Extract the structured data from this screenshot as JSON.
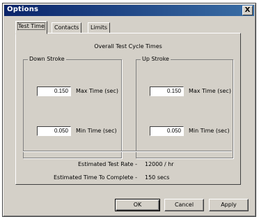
{
  "window": {
    "title": "Options",
    "close_glyph": "X"
  },
  "tabs": [
    {
      "label": "Test Time",
      "active": true
    },
    {
      "label": "Contacts",
      "active": false
    },
    {
      "label": "Limits",
      "active": false
    }
  ],
  "panel": {
    "heading": "Overall Test Cycle Times",
    "down_stroke": {
      "label": "Down Stroke",
      "max_value": "0.150",
      "max_label": "Max Time (sec)",
      "min_value": "0.050",
      "min_label": "Min Time (sec)"
    },
    "up_stroke": {
      "label": "Up Stroke",
      "max_value": "0.150",
      "max_label": "Max Time (sec)",
      "min_value": "0.050",
      "min_label": "Min Time (sec)"
    },
    "estimated_rate_label": "Estimated Test Rate -",
    "estimated_rate_value": "12000 / hr",
    "estimated_time_label": "Estimated Time To Complete -",
    "estimated_time_value": "150 secs"
  },
  "buttons": {
    "ok": "OK",
    "cancel": "Cancel",
    "apply": "Apply"
  }
}
